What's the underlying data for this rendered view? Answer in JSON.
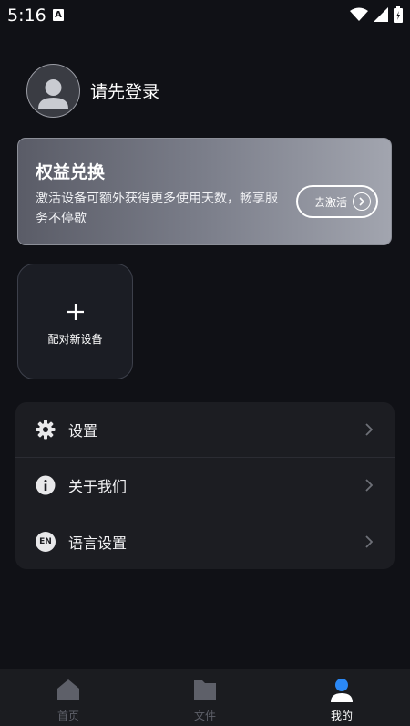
{
  "status_bar": {
    "time": "5:16",
    "notification_badge": "A"
  },
  "profile": {
    "login_prompt": "请先登录"
  },
  "redeem_card": {
    "title": "权益兑换",
    "description": "激活设备可额外获得更多使用天数，畅享服务不停歇",
    "activate_label": "去激活"
  },
  "pair_device": {
    "label": "配对新设备"
  },
  "menu": [
    {
      "label": "设置",
      "icon": "gear-icon"
    },
    {
      "label": "关于我们",
      "icon": "info-icon"
    },
    {
      "label": "语言设置",
      "icon": "language-icon",
      "icon_text": "EN"
    }
  ],
  "bottom_nav": {
    "items": [
      {
        "label": "首页",
        "icon": "home-icon",
        "active": false
      },
      {
        "label": "文件",
        "icon": "folder-icon",
        "active": false
      },
      {
        "label": "我的",
        "icon": "profile-icon",
        "active": true
      }
    ],
    "active_color": "#2b88f5",
    "inactive_color": "#5e6069"
  },
  "colors": {
    "background": "#101116",
    "card": "#1c1d22"
  }
}
